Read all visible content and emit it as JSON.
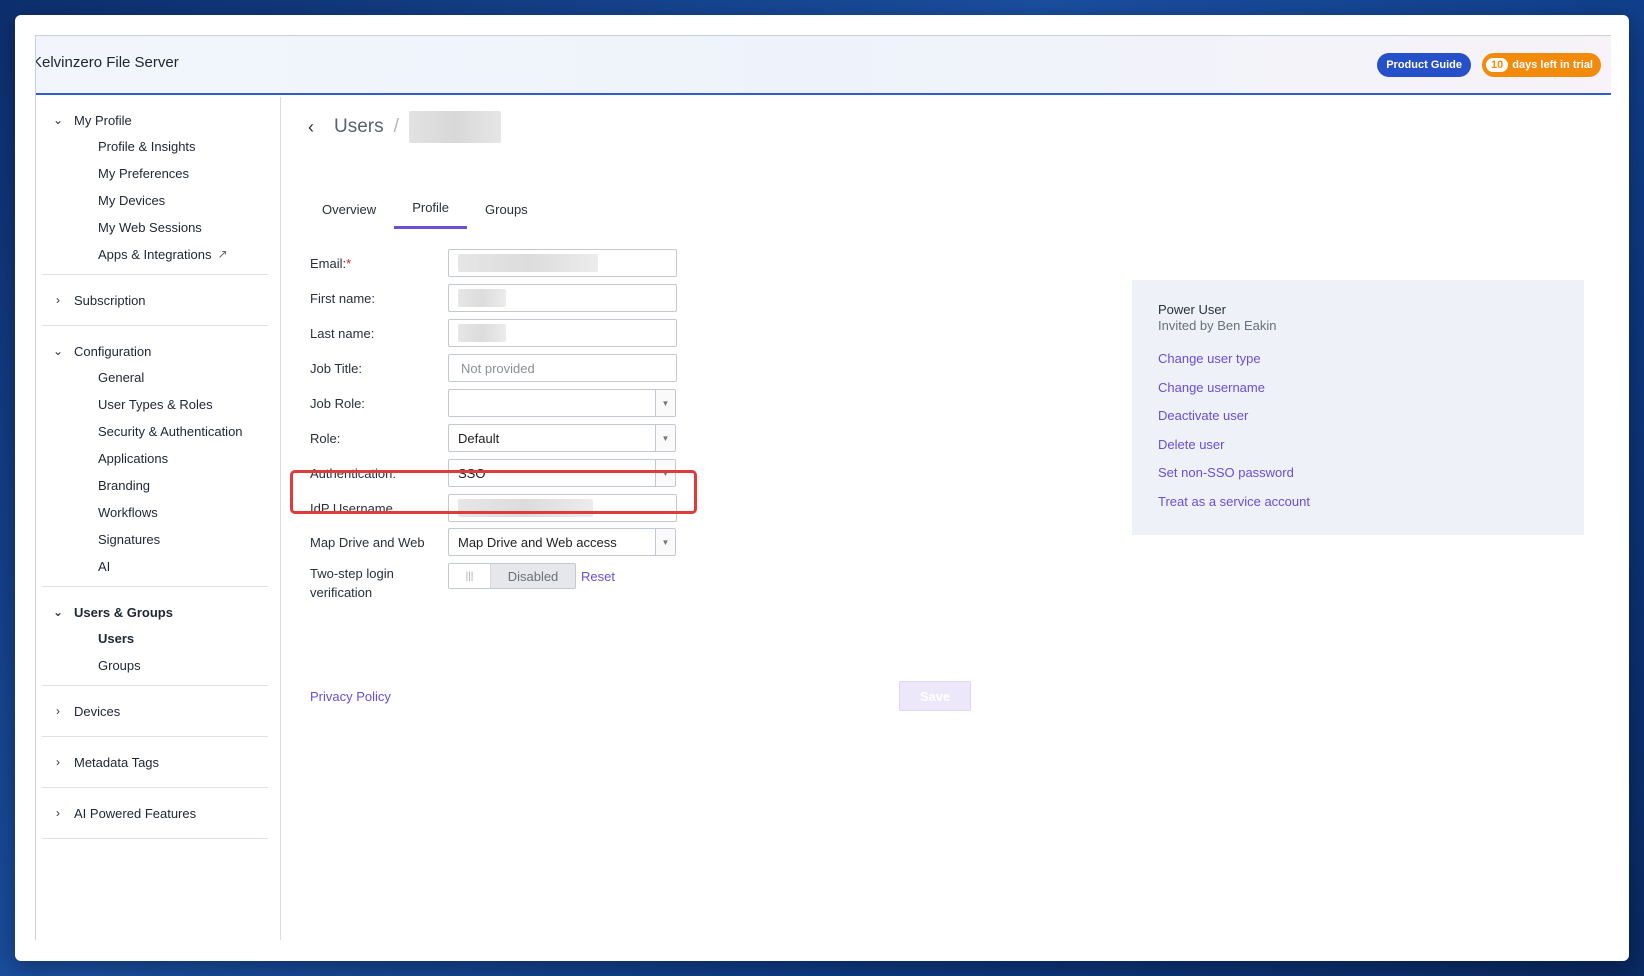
{
  "app": {
    "title": "Kelvinzero File Server",
    "product_guide_label": "Product Guide",
    "trial_days": "10",
    "trial_text": "days left in trial"
  },
  "sidebar": {
    "my_profile": {
      "label": "My Profile",
      "items": [
        "Profile & Insights",
        "My Preferences",
        "My Devices",
        "My Web Sessions",
        "Apps & Integrations"
      ]
    },
    "subscription": {
      "label": "Subscription"
    },
    "configuration": {
      "label": "Configuration",
      "items": [
        "General",
        "User Types & Roles",
        "Security & Authentication",
        "Applications",
        "Branding",
        "Workflows",
        "Signatures",
        "AI"
      ]
    },
    "users_groups": {
      "label": "Users & Groups",
      "items": [
        "Users",
        "Groups"
      ],
      "active": "Users"
    },
    "devices": {
      "label": "Devices"
    },
    "metadata_tags": {
      "label": "Metadata Tags"
    },
    "ai_features": {
      "label": "AI Powered Features"
    }
  },
  "breadcrumb": {
    "root": "Users",
    "separator": "/"
  },
  "tabs": [
    "Overview",
    "Profile",
    "Groups"
  ],
  "active_tab": "Profile",
  "form": {
    "email_label": "Email:",
    "email_required": "*",
    "first_name_label": "First name:",
    "last_name_label": "Last name:",
    "job_title_label": "Job Title:",
    "job_title_placeholder": "Not provided",
    "job_role_label": "Job Role:",
    "job_role_value": "",
    "role_label": "Role:",
    "role_value": "Default",
    "auth_label": "Authentication:",
    "auth_value": "SSO",
    "idp_label": "IdP Username",
    "map_label": "Map Drive and Web",
    "map_value": "Map Drive and Web access",
    "two_step_label_1": "Two-step login",
    "two_step_label_2": "verification",
    "two_step_state": "Disabled",
    "reset_label": "Reset"
  },
  "footer": {
    "privacy_label": "Privacy Policy",
    "save_label": "Save"
  },
  "panel": {
    "user_type": "Power User",
    "invited_by": "Invited by Ben Eakin",
    "links": [
      "Change user type",
      "Change username",
      "Deactivate user",
      "Delete user",
      "Set non-SSO password",
      "Treat as a service account"
    ]
  },
  "colors": {
    "accent": "#6b4ed8",
    "brand_blue": "#2550c8",
    "trial_orange": "#f28a0c",
    "highlight_red": "#e03a3a"
  }
}
